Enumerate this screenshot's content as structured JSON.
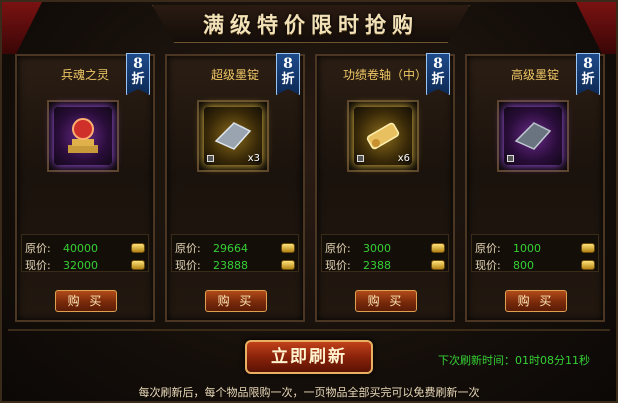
{
  "title": "满级特价限时抢购",
  "discount_badge": {
    "number": "8",
    "unit": "折"
  },
  "price_labels": {
    "original": "原价:",
    "current": "现价:"
  },
  "buy_label": "购 买",
  "items": [
    {
      "name": "兵魂之灵",
      "original_price": "40000",
      "current_price": "32000",
      "quantity": "",
      "quality": "purple",
      "icon": "soul-altar-icon"
    },
    {
      "name": "超级墨锭",
      "original_price": "29664",
      "current_price": "23888",
      "quantity": "x3",
      "quality": "gold",
      "icon": "ink-stone-icon"
    },
    {
      "name": "功绩卷轴（中）",
      "original_price": "3000",
      "current_price": "2388",
      "quantity": "x6",
      "quality": "gold",
      "icon": "scroll-icon"
    },
    {
      "name": "高级墨锭",
      "original_price": "1000",
      "current_price": "800",
      "quantity": "",
      "quality": "purple",
      "icon": "ink-stone-icon"
    }
  ],
  "refresh_button": "立即刷新",
  "next_refresh_label": "下次刷新时间：",
  "next_refresh_time": "01时08分11秒",
  "footer_note": "每次刷新后，每个物品限购一次，一页物品全部买完可以免费刷新一次",
  "colors": {
    "price_green": "#35d035",
    "name_gold": "#f0c866",
    "badge_blue": "#1e4a8a"
  }
}
